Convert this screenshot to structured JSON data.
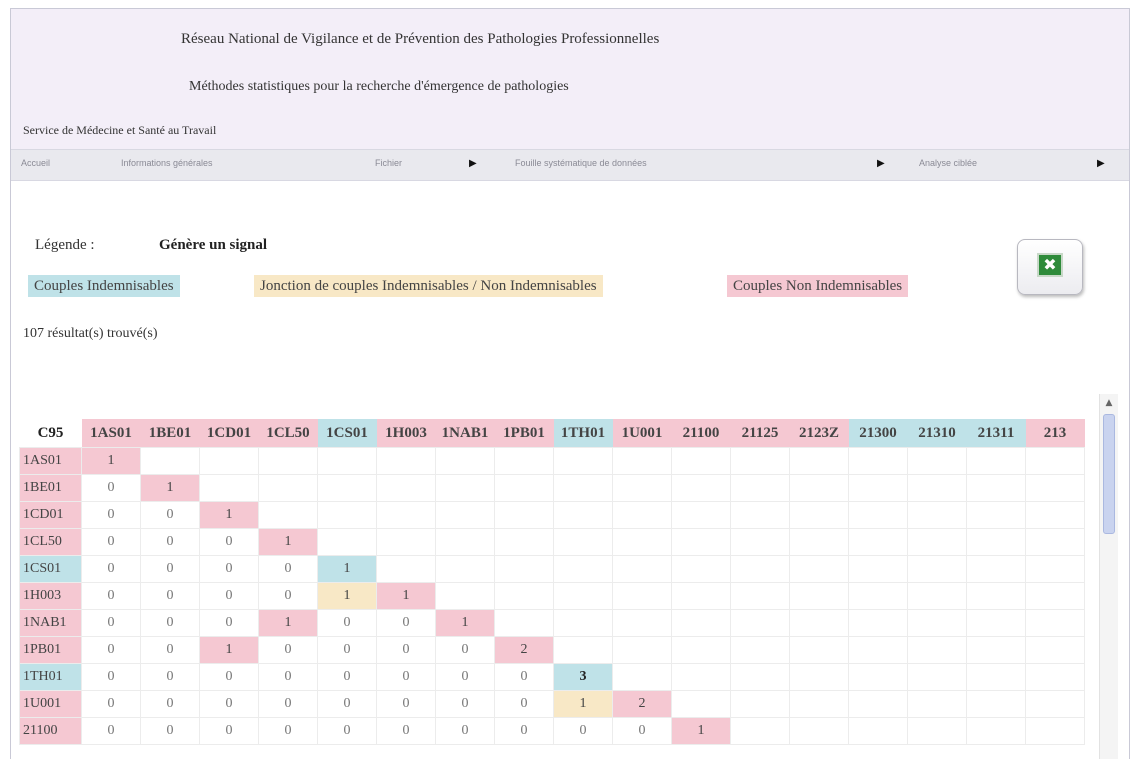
{
  "header": {
    "title_line1": "Réseau National de Vigilance et de Prévention des Pathologies Professionnelles",
    "title_line2": "Méthodes statistiques pour la recherche d'émergence de pathologies",
    "service": "Service de Médecine et Santé au Travail"
  },
  "nav": {
    "items": [
      "Accueil",
      "Informations générales",
      "Fichier",
      "Fouille systématique de données",
      "Analyse ciblée"
    ],
    "arrow_icon": "triangle-right-icon"
  },
  "legend": {
    "label": "Légende :",
    "signal": "Génère un signal",
    "blue_label": "Couples Indemnisables",
    "yellow_label": "Jonction de couples Indemnisables / Non Indemnisables",
    "pink_label": "Couples Non Indemnisables",
    "colors": {
      "blue": "#bfe2e8",
      "yellow": "#f8e8c6",
      "pink": "#f5c8d2"
    }
  },
  "results_text": "107 résultat(s) trouvé(s)",
  "export_icon": "excel-icon",
  "matrix": {
    "corner": "C95",
    "columns": [
      {
        "label": "1AS01",
        "color": "pink"
      },
      {
        "label": "1BE01",
        "color": "pink"
      },
      {
        "label": "1CD01",
        "color": "pink"
      },
      {
        "label": "1CL50",
        "color": "pink"
      },
      {
        "label": "1CS01",
        "color": "blue"
      },
      {
        "label": "1H003",
        "color": "pink"
      },
      {
        "label": "1NAB1",
        "color": "pink"
      },
      {
        "label": "1PB01",
        "color": "pink"
      },
      {
        "label": "1TH01",
        "color": "blue"
      },
      {
        "label": "1U001",
        "color": "pink"
      },
      {
        "label": "21100",
        "color": "pink"
      },
      {
        "label": "21125",
        "color": "pink"
      },
      {
        "label": "2123Z",
        "color": "pink"
      },
      {
        "label": "21300",
        "color": "blue"
      },
      {
        "label": "21310",
        "color": "blue"
      },
      {
        "label": "21311",
        "color": "blue"
      },
      {
        "label": "213",
        "color": "pink"
      }
    ],
    "rows": [
      {
        "label": "1AS01",
        "color": "pink",
        "values": [
          "1"
        ],
        "colors": [
          "pink"
        ],
        "bold": []
      },
      {
        "label": "1BE01",
        "color": "pink",
        "values": [
          "0",
          "1"
        ],
        "colors": [
          "",
          "pink"
        ],
        "bold": []
      },
      {
        "label": "1CD01",
        "color": "pink",
        "values": [
          "0",
          "0",
          "1"
        ],
        "colors": [
          "",
          "",
          "pink"
        ],
        "bold": []
      },
      {
        "label": "1CL50",
        "color": "pink",
        "values": [
          "0",
          "0",
          "0",
          "1"
        ],
        "colors": [
          "",
          "",
          "",
          "pink"
        ],
        "bold": []
      },
      {
        "label": "1CS01",
        "color": "blue",
        "values": [
          "0",
          "0",
          "0",
          "0",
          "1"
        ],
        "colors": [
          "",
          "",
          "",
          "",
          "blue"
        ],
        "bold": []
      },
      {
        "label": "1H003",
        "color": "pink",
        "values": [
          "0",
          "0",
          "0",
          "0",
          "1",
          "1"
        ],
        "colors": [
          "",
          "",
          "",
          "",
          "yellow",
          "pink"
        ],
        "bold": []
      },
      {
        "label": "1NAB1",
        "color": "pink",
        "values": [
          "0",
          "0",
          "0",
          "1",
          "0",
          "0",
          "1"
        ],
        "colors": [
          "",
          "",
          "",
          "pink",
          "",
          "",
          "pink"
        ],
        "bold": []
      },
      {
        "label": "1PB01",
        "color": "pink",
        "values": [
          "0",
          "0",
          "1",
          "0",
          "0",
          "0",
          "0",
          "2"
        ],
        "colors": [
          "",
          "",
          "pink",
          "",
          "",
          "",
          "",
          "pink"
        ],
        "bold": []
      },
      {
        "label": "1TH01",
        "color": "blue",
        "values": [
          "0",
          "0",
          "0",
          "0",
          "0",
          "0",
          "0",
          "0",
          "3"
        ],
        "colors": [
          "",
          "",
          "",
          "",
          "",
          "",
          "",
          "",
          "blue"
        ],
        "bold": [
          8
        ]
      },
      {
        "label": "1U001",
        "color": "pink",
        "values": [
          "0",
          "0",
          "0",
          "0",
          "0",
          "0",
          "0",
          "0",
          "1",
          "2"
        ],
        "colors": [
          "",
          "",
          "",
          "",
          "",
          "",
          "",
          "",
          "yellow",
          "pink"
        ],
        "bold": []
      },
      {
        "label": "21100",
        "color": "pink",
        "values": [
          "0",
          "0",
          "0",
          "0",
          "0",
          "0",
          "0",
          "0",
          "0",
          "0",
          "1"
        ],
        "colors": [
          "",
          "",
          "",
          "",
          "",
          "",
          "",
          "",
          "",
          "",
          "pink"
        ],
        "bold": []
      }
    ]
  }
}
